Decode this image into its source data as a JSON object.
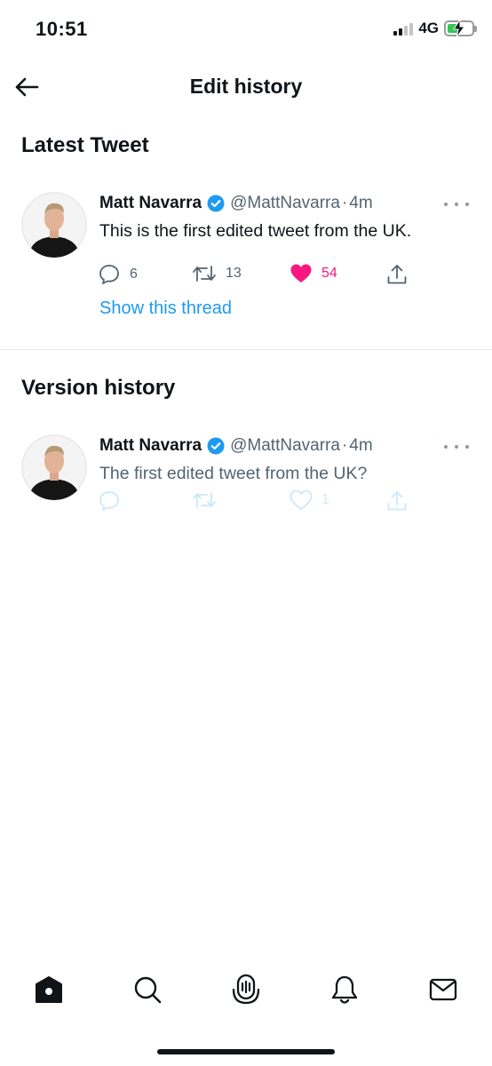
{
  "status_bar": {
    "time": "10:51",
    "network": "4G"
  },
  "header": {
    "title": "Edit history",
    "back_icon": "arrow-left-icon"
  },
  "latest": {
    "section_title": "Latest Tweet",
    "tweet": {
      "name": "Matt Navarra",
      "handle": "@MattNavarra",
      "separator": "·",
      "time": "4m",
      "text": "This is the first edited tweet from the UK.",
      "replies": "6",
      "retweets": "13",
      "likes": "54",
      "liked": true
    },
    "thread_link": "Show this thread"
  },
  "history": {
    "section_title": "Version history",
    "tweet": {
      "name": "Matt Navarra",
      "handle": "@MattNavarra",
      "separator": "·",
      "time": "4m",
      "text": "The first edited tweet from the UK?",
      "likes": "1"
    }
  },
  "tab_bar": {
    "items": [
      "home-icon",
      "search-icon",
      "spaces-icon",
      "notifications-icon",
      "messages-icon"
    ]
  },
  "colors": {
    "accent": "#1d9bf0",
    "like": "#f91880",
    "text": "#0f1419",
    "muted": "#536471"
  }
}
